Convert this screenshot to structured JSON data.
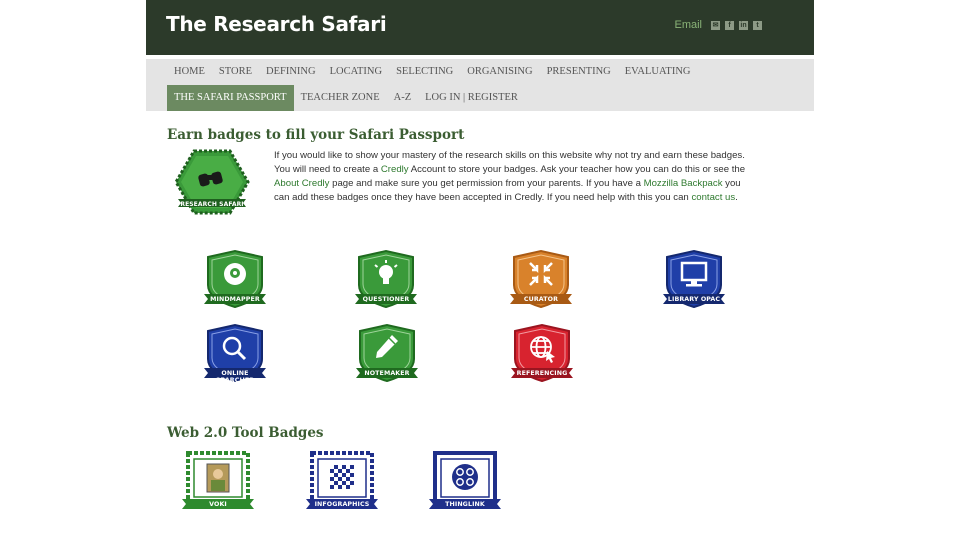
{
  "header": {
    "title": "The Research Safari",
    "email_label": "Email",
    "social_icons": [
      "email-icon",
      "facebook-icon",
      "linkedin-icon",
      "twitter-icon"
    ]
  },
  "nav": {
    "row1": [
      "HOME",
      "STORE",
      "DEFINING",
      "LOCATING",
      "SELECTING",
      "ORGANISING",
      "PRESENTING",
      "EVALUATING"
    ],
    "row2": [
      "THE SAFARI PASSPORT",
      "TEACHER ZONE",
      "A-Z",
      "LOG IN | REGISTER"
    ],
    "active": "THE SAFARI PASSPORT"
  },
  "section1": {
    "heading": "Earn badges to fill your Safari Passport",
    "main_badge_label": "RESEARCH SAFARI",
    "intro": {
      "t1": "If you would like to show your mastery of the research skills on this website why not try and earn these badges. You will need to create a ",
      "l1": "Credly",
      "t2": " Account to store your badges. Ask your teacher how you can do this or see the ",
      "l2": "About Credly",
      "t3": " page and make sure you get permission from your parents. If you have a ",
      "l3": "Mozzilla Backpack",
      "t4": " you can add these badges once they have been accepted in Credly. If you need help with this you can ",
      "l4": "contact us",
      "t5": "."
    },
    "badges": [
      {
        "label": "MINDMAPPER",
        "icon": "mind-map-head-icon",
        "color": "#3a9a3a"
      },
      {
        "label": "QUESTIONER",
        "icon": "lightbulb-icon",
        "color": "#3a9a3a"
      },
      {
        "label": "CURATOR",
        "icon": "compress-arrows-icon",
        "color": "#d9822b"
      },
      {
        "label": "LIBRARY OPAC",
        "icon": "computer-monitor-icon",
        "color": "#1f3fa8"
      },
      {
        "label": "ONLINE SEARCHER",
        "icon": "magnifier-icon",
        "color": "#1f3fa8"
      },
      {
        "label": "NOTEMAKER",
        "icon": "pencil-icon",
        "color": "#3a9a3a"
      },
      {
        "label": "REFERENCING",
        "icon": "globe-cursor-icon",
        "color": "#d8232f"
      }
    ]
  },
  "section2": {
    "heading": "Web 2.0 Tool Badges",
    "badges": [
      {
        "label": "VOKI",
        "icon": "voki-avatar-icon",
        "color": "#2e8a2e"
      },
      {
        "label": "INFOGRAPHICS",
        "icon": "checkerboard-icon",
        "color": "#1f2f8a"
      },
      {
        "label": "THINGLINK",
        "icon": "thinglink-icon",
        "color": "#1f2f8a"
      }
    ]
  }
}
